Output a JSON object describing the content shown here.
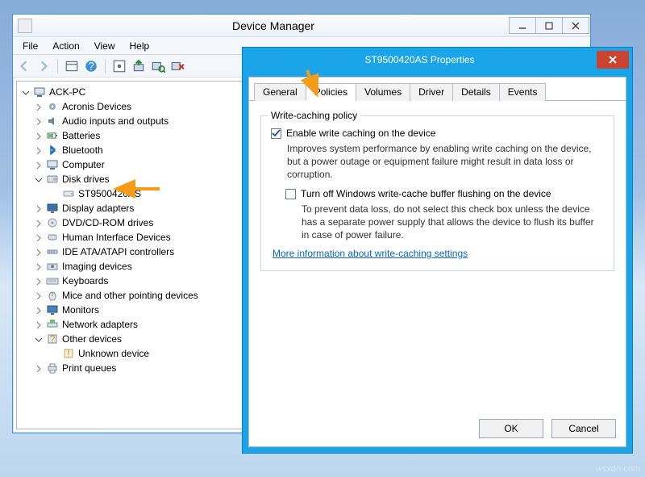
{
  "dm": {
    "title": "Device Manager",
    "menus": [
      "File",
      "Action",
      "View",
      "Help"
    ],
    "root": "ACK-PC",
    "nodes": [
      {
        "label": "Acronis Devices",
        "icon": "gear"
      },
      {
        "label": "Audio inputs and outputs",
        "icon": "audio"
      },
      {
        "label": "Batteries",
        "icon": "battery"
      },
      {
        "label": "Bluetooth",
        "icon": "bt"
      },
      {
        "label": "Computer",
        "icon": "pc"
      },
      {
        "label": "Disk drives",
        "icon": "disk",
        "expanded": true,
        "children": [
          {
            "label": "ST9500420AS",
            "icon": "hdd"
          }
        ]
      },
      {
        "label": "Display adapters",
        "icon": "display"
      },
      {
        "label": "DVD/CD-ROM drives",
        "icon": "dvd"
      },
      {
        "label": "Human Interface Devices",
        "icon": "hid"
      },
      {
        "label": "IDE ATA/ATAPI controllers",
        "icon": "ide"
      },
      {
        "label": "Imaging devices",
        "icon": "imaging"
      },
      {
        "label": "Keyboards",
        "icon": "keyboard"
      },
      {
        "label": "Mice and other pointing devices",
        "icon": "mouse"
      },
      {
        "label": "Monitors",
        "icon": "monitor"
      },
      {
        "label": "Network adapters",
        "icon": "net"
      },
      {
        "label": "Other devices",
        "icon": "other",
        "expanded": true,
        "children": [
          {
            "label": "Unknown device",
            "icon": "unknown"
          }
        ]
      },
      {
        "label": "Print queues",
        "icon": "print"
      }
    ]
  },
  "props": {
    "title": "ST9500420AS Properties",
    "tabs": [
      "General",
      "Policies",
      "Volumes",
      "Driver",
      "Details",
      "Events"
    ],
    "active_tab": "Policies",
    "group_title": "Write-caching policy",
    "chk1_label": "Enable write caching on the device",
    "chk1_desc": "Improves system performance by enabling write caching on the device, but a power outage or equipment failure might result in data loss or corruption.",
    "chk2_label": "Turn off Windows write-cache buffer flushing on the device",
    "chk2_desc": "To prevent data loss, do not select this check box unless the device has a separate power supply that allows the device to flush its buffer in case of power failure.",
    "link": "More information about write-caching settings",
    "ok": "OK",
    "cancel": "Cancel"
  },
  "watermark": "wsxdn.com"
}
